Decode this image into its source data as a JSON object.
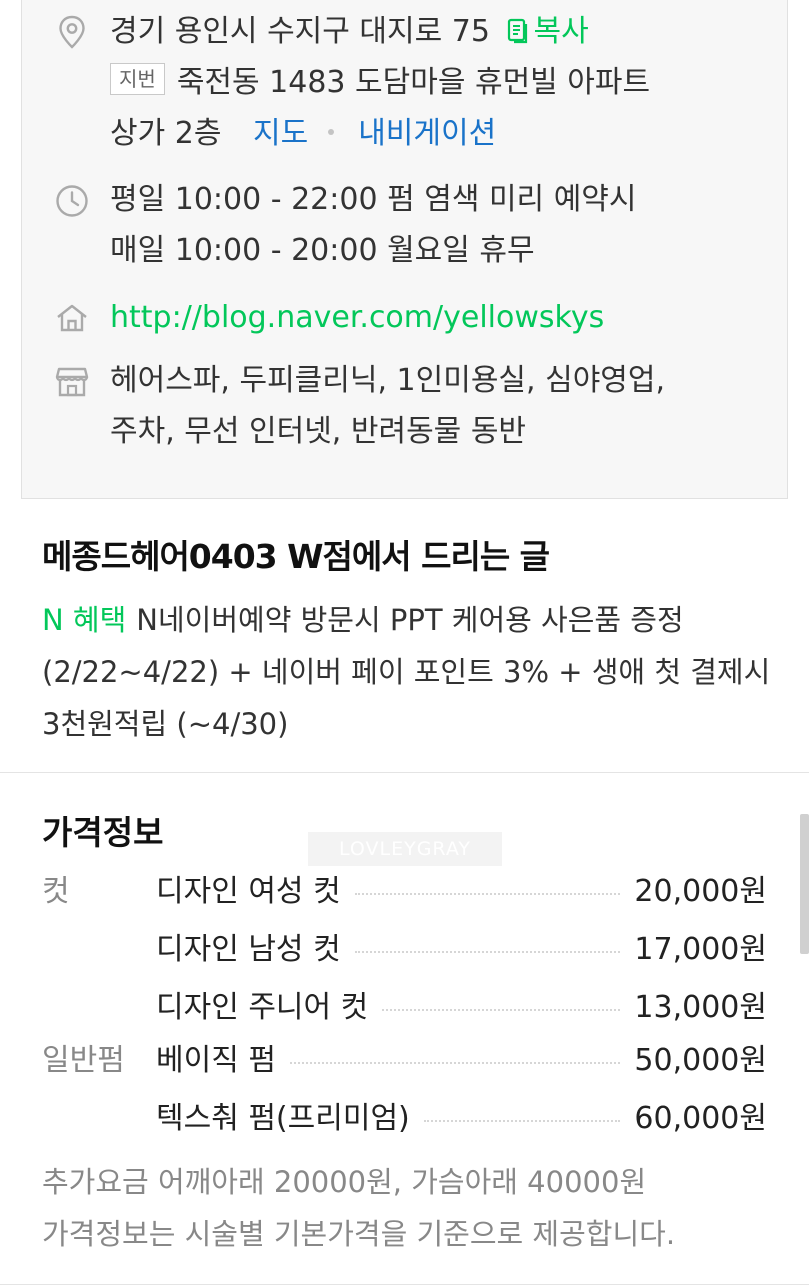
{
  "address": {
    "road": "경기 용인시 수지구 대지로 75",
    "copy_label": "복사",
    "jibun_badge": "지번",
    "jibun_line1": "죽전동 1483 도담마을 휴먼빌 아파트",
    "jibun_line2": "상가 2층",
    "map_label": "지도",
    "navigation_label": "내비게이션"
  },
  "hours": {
    "line1": "평일 10:00 - 22:00 펌 염색 미리 예약시",
    "line2": "매일 10:00 - 20:00 월요일 휴무"
  },
  "homepage": "http://blog.naver.com/yellowskys",
  "amenities": {
    "line1": "헤어스파, 두피클리닉, 1인미용실, 심야영업,",
    "line2": "주차, 무선 인터넷, 반려동물 동반"
  },
  "notice": {
    "title": "메종드헤어0403 W점에서 드리는 글",
    "benefit_label": "N 혜택",
    "body": "N네이버예약 방문시 PPT 케어용 사은품 증정 (2/22~4/22) + 네이버 페이 포인트 3% + 생애 첫 결제시 3천원적립 (~4/30)"
  },
  "price": {
    "title": "가격정보",
    "watermark": "LOVLEYGRAY",
    "rows": [
      {
        "category": "컷",
        "name": "디자인 여성 컷",
        "price": "20,000원"
      },
      {
        "category": "",
        "name": "디자인 남성 컷",
        "price": "17,000원"
      },
      {
        "category": "",
        "name": "디자인 주니어 컷",
        "price": "13,000원"
      },
      {
        "category": "일반펌",
        "name": "베이직 펌",
        "price": "50,000원"
      },
      {
        "category": "",
        "name": "텍스춰 펌(프리미엄)",
        "price": "60,000원"
      }
    ],
    "note1": "추가요금 어깨아래 20000원, 가슴아래 40000원",
    "note2": "가격정보는 시술별 기본가격을 기준으로 제공합니다."
  },
  "icons": [
    "location-pin-icon",
    "copy-icon",
    "clock-icon",
    "home-icon",
    "store-icon"
  ],
  "colors": {
    "accent_green": "#03c75a",
    "link_blue": "#1a73c9",
    "panel_bg": "#f7f7f7"
  }
}
